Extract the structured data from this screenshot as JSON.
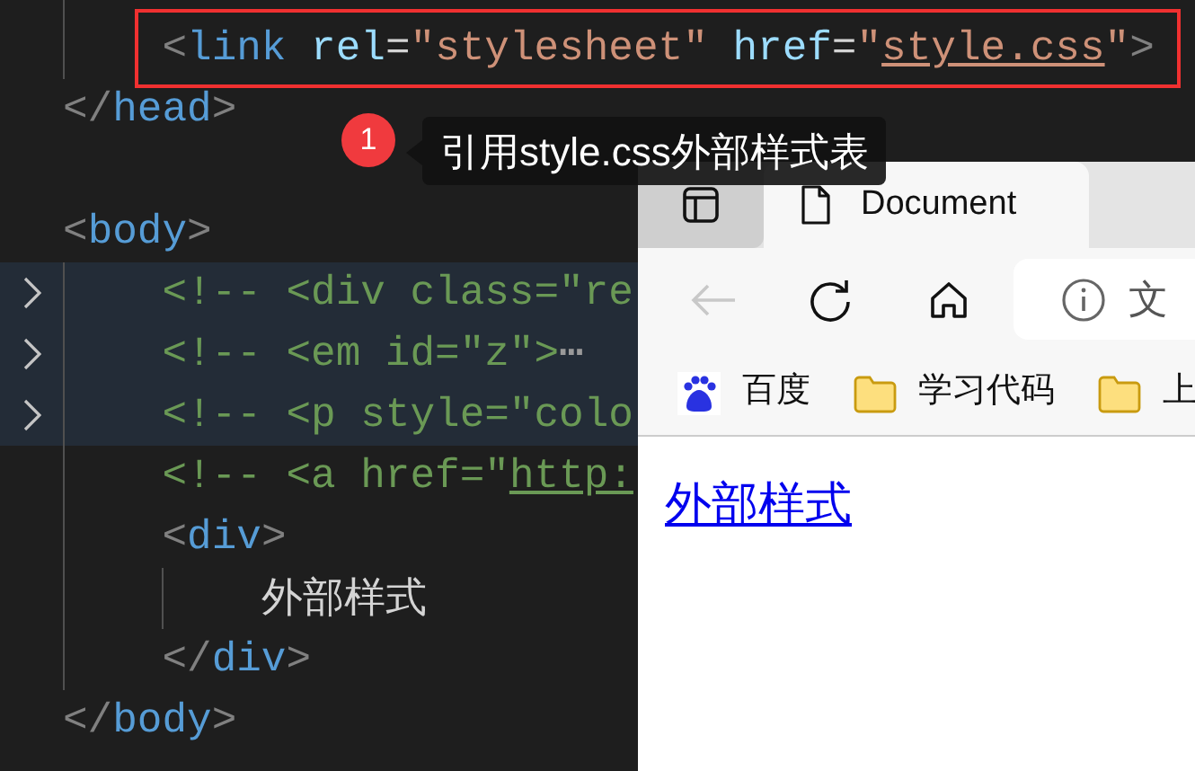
{
  "editor": {
    "lines": [
      {
        "kind": "group",
        "children": [
          {
            "kind": "code",
            "folded": false,
            "boxed": true,
            "tokens": [
              {
                "kind": "punct",
                "text": "<"
              },
              {
                "kind": "tag",
                "text": "link"
              },
              {
                "kind": "attr",
                "text": " rel"
              },
              {
                "kind": "plain",
                "text": "="
              },
              {
                "kind": "string",
                "text": "\"stylesheet\""
              },
              {
                "kind": "attr",
                "text": " href"
              },
              {
                "kind": "plain",
                "text": "="
              },
              {
                "kind": "string",
                "text": "\""
              },
              {
                "kind": "stringlink",
                "text": "style.css"
              },
              {
                "kind": "string",
                "text": "\""
              },
              {
                "kind": "punct",
                "text": ">"
              }
            ]
          }
        ]
      },
      {
        "kind": "code",
        "folded": false,
        "boxed": false,
        "tokens": [
          {
            "kind": "punct",
            "text": "</"
          },
          {
            "kind": "tag",
            "text": "head"
          },
          {
            "kind": "punct",
            "text": ">"
          }
        ]
      },
      {
        "kind": "blank"
      },
      {
        "kind": "code",
        "folded": false,
        "boxed": false,
        "tokens": [
          {
            "kind": "punct",
            "text": "<"
          },
          {
            "kind": "tag",
            "text": "body"
          },
          {
            "kind": "punct",
            "text": ">"
          }
        ],
        "children": [
          {
            "kind": "code",
            "folded": true,
            "boxed": false,
            "tokens": [
              {
                "kind": "comment",
                "text": "<!-- <div class=\"re"
              }
            ]
          },
          {
            "kind": "code",
            "folded": true,
            "boxed": false,
            "tokens": [
              {
                "kind": "comment",
                "text": "<!-- <em id=\"z\">"
              },
              {
                "kind": "fold",
                "text": "⋯"
              }
            ]
          },
          {
            "kind": "code",
            "folded": true,
            "boxed": false,
            "tokens": [
              {
                "kind": "comment",
                "text": "<!-- <p style=\"colo"
              }
            ]
          },
          {
            "kind": "code",
            "folded": false,
            "boxed": false,
            "tokens": [
              {
                "kind": "comment",
                "text": "<!-- <a href=\""
              },
              {
                "kind": "commentlink",
                "text": "http:"
              }
            ]
          },
          {
            "kind": "code",
            "folded": false,
            "boxed": false,
            "tokens": [
              {
                "kind": "punct",
                "text": "<"
              },
              {
                "kind": "tag",
                "text": "div"
              },
              {
                "kind": "punct",
                "text": ">"
              }
            ],
            "children": [
              {
                "kind": "code",
                "folded": false,
                "boxed": false,
                "tokens": [
                  {
                    "kind": "plain",
                    "text": "外部样式"
                  }
                ]
              }
            ]
          },
          {
            "kind": "code",
            "folded": false,
            "boxed": false,
            "tokens": [
              {
                "kind": "punct",
                "text": "</"
              },
              {
                "kind": "tag",
                "text": "div"
              },
              {
                "kind": "punct",
                "text": ">"
              }
            ]
          }
        ]
      },
      {
        "kind": "code",
        "folded": false,
        "boxed": false,
        "tokens": [
          {
            "kind": "punct",
            "text": "</"
          },
          {
            "kind": "tag",
            "text": "body"
          },
          {
            "kind": "punct",
            "text": ">"
          }
        ]
      }
    ]
  },
  "annotation": {
    "badge": "1",
    "text": "引用style.css外部样式表"
  },
  "browser": {
    "tabs": [
      {
        "title": "Document",
        "selected": true
      }
    ],
    "back_disabled": true,
    "address": {
      "text": "文"
    },
    "bookmarks": [
      {
        "kind": "site",
        "label": "百度"
      },
      {
        "kind": "folder",
        "label": "学习代码"
      },
      {
        "kind": "folder",
        "label": "上"
      }
    ],
    "content": {
      "link": "外部样式"
    }
  }
}
